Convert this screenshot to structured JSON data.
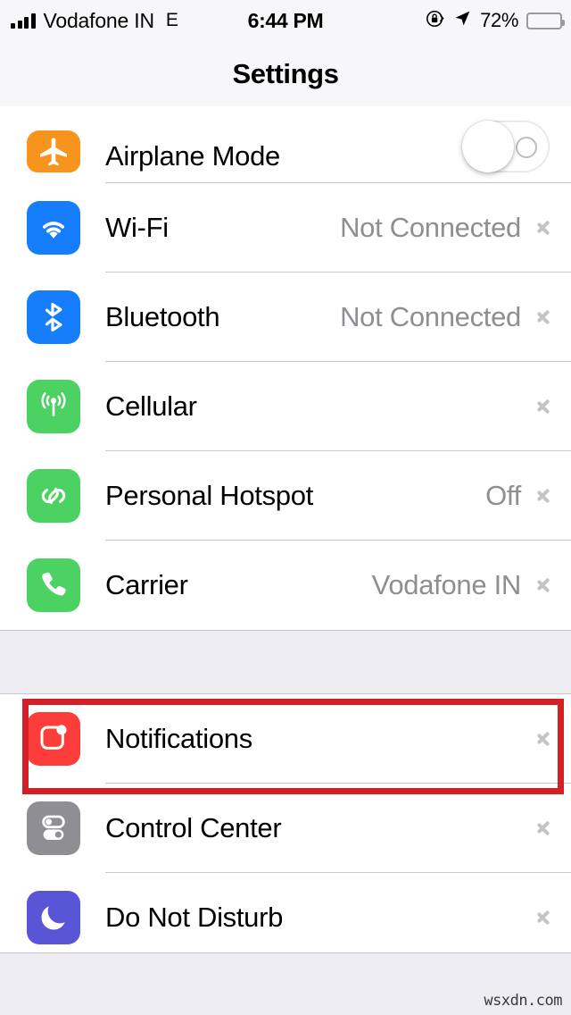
{
  "status_bar": {
    "signal_icon": "signal-bars-icon",
    "signal_bars": 4,
    "carrier": "Vodafone IN",
    "network_type": "E",
    "time": "6:44 PM",
    "rotation_lock_icon": "rotation-lock-icon",
    "location_icon": "location-arrow-icon",
    "battery_percent": "72%",
    "battery_level": 72,
    "battery_icon": "battery-icon"
  },
  "navbar": {
    "title": "Settings"
  },
  "groups": [
    {
      "rows": [
        {
          "icon": "airplane-icon",
          "label": "Airplane Mode",
          "accessory": "toggle",
          "toggle_on": false,
          "color": "#f7941e",
          "clipped": true
        },
        {
          "icon": "wifi-icon",
          "label": "Wi-Fi",
          "value": "Not Connected",
          "accessory": "chevron",
          "color": "#167efb"
        },
        {
          "icon": "bluetooth-icon",
          "label": "Bluetooth",
          "value": "Not Connected",
          "accessory": "chevron",
          "color": "#167efb"
        },
        {
          "icon": "cellular-icon",
          "label": "Cellular",
          "value": "",
          "accessory": "chevron",
          "color": "#4cd263"
        },
        {
          "icon": "hotspot-icon",
          "label": "Personal Hotspot",
          "value": "Off",
          "accessory": "chevron",
          "color": "#4cd263"
        },
        {
          "icon": "phone-icon",
          "label": "Carrier",
          "value": "Vodafone IN",
          "accessory": "chevron",
          "color": "#4cd263"
        }
      ]
    },
    {
      "rows": [
        {
          "icon": "notifications-icon",
          "label": "Notifications",
          "value": "",
          "accessory": "chevron",
          "color": "#fc3d39",
          "highlighted": true
        },
        {
          "icon": "control-center-icon",
          "label": "Control Center",
          "value": "",
          "accessory": "chevron",
          "color": "#8e8e93"
        },
        {
          "icon": "moon-icon",
          "label": "Do Not Disturb",
          "value": "",
          "accessory": "chevron",
          "color": "#5856d6"
        }
      ]
    }
  ],
  "annotation": {
    "color": "#d12026",
    "target": "Notifications"
  },
  "watermark": "wsxdn.com"
}
